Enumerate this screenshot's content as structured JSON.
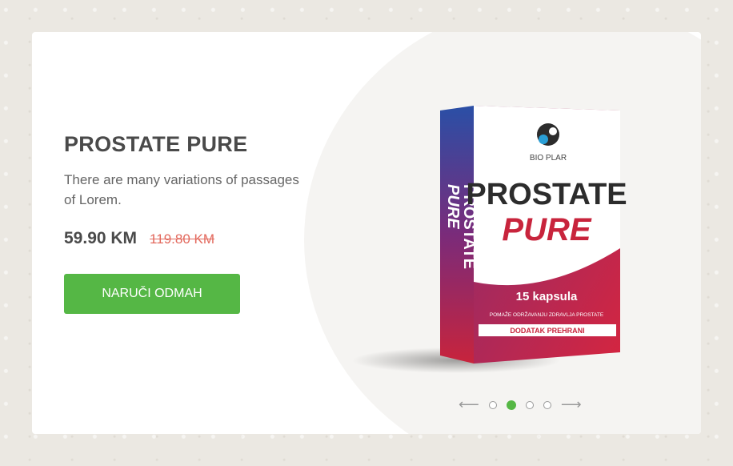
{
  "product": {
    "title": "PROSTATE PURE",
    "description": "There are many variations of passages of Lorem.",
    "price": "59.90 KM",
    "old_price": "119.80 KM",
    "cta_label": "NARUČI ODMAH"
  },
  "box": {
    "brand": "BIO PLAR",
    "name_line1": "PROSTATE",
    "name_line2": "PURE",
    "capsules": "15 kapsula",
    "claim": "POMAŽE ODRŽAVANJU ZDRAVLJA PROSTATE",
    "supplement": "DODATAK PREHRANI",
    "side_line1": "PROSTATE",
    "side_line2": "PURE"
  },
  "slider": {
    "slides": 4,
    "active_index": 1
  },
  "colors": {
    "accent": "#55b745",
    "old_price": "#e36a5e",
    "box_red": "#c8243c",
    "box_blue": "#2a4fa6"
  }
}
